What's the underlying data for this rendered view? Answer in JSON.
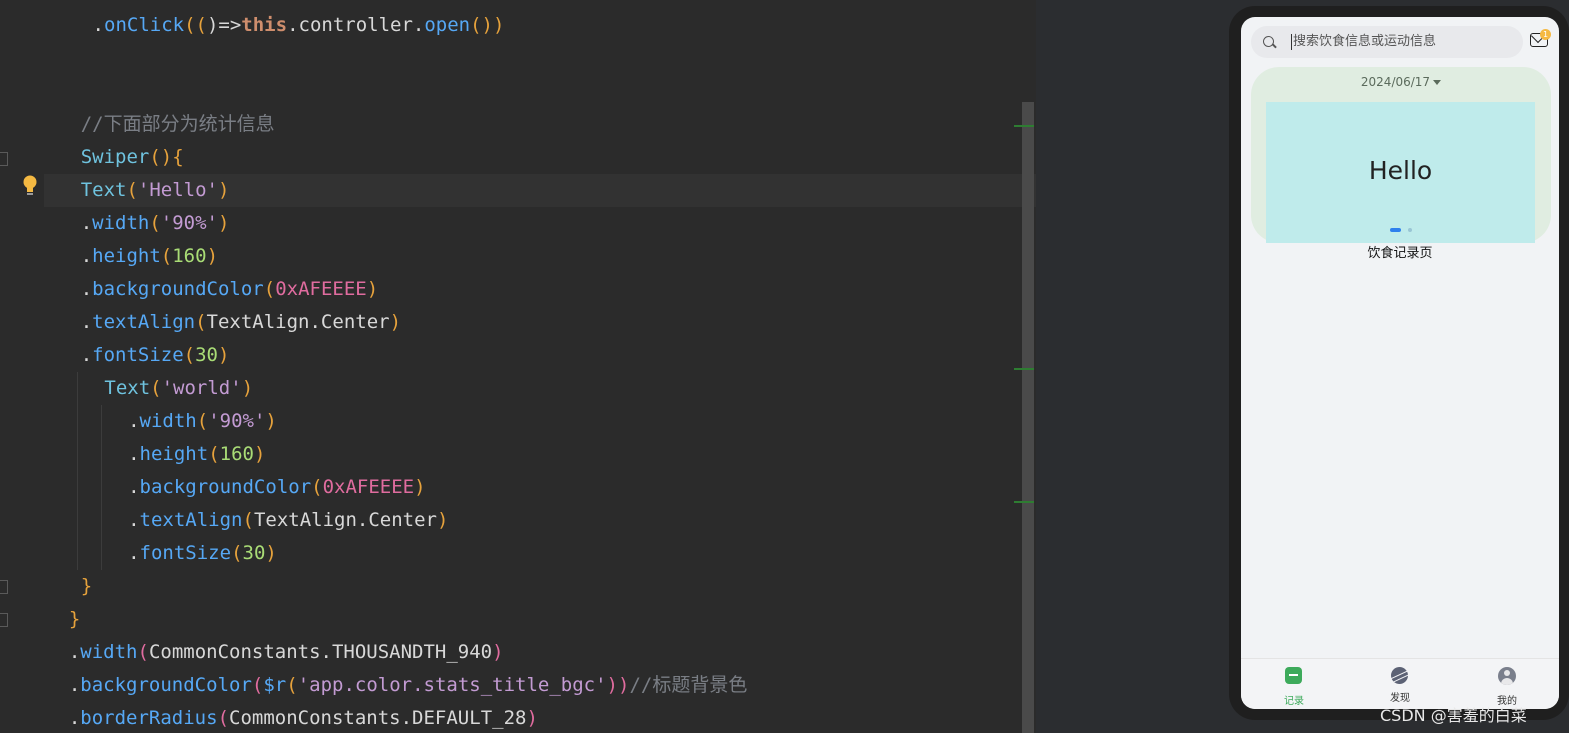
{
  "editor": {
    "lines": [
      {
        "indent": "   ",
        "tokens": [
          {
            "t": ".",
            "c": "#d8d8d8"
          },
          {
            "t": "onClick",
            "c": "#56a8f5"
          },
          {
            "t": "((",
            "c": "#e6a23c"
          },
          {
            "t": ")=>",
            "c": "#d8d8d8"
          },
          {
            "t": "this",
            "c": "#cf8e6d"
          },
          {
            "t": ".controller.",
            "c": "#d8d8d8"
          },
          {
            "t": "open",
            "c": "#56a8f5"
          },
          {
            "t": "())",
            "c": "#e6a23c"
          }
        ]
      },
      {
        "indent": "",
        "tokens": []
      },
      {
        "indent": "",
        "tokens": []
      },
      {
        "indent": "  ",
        "tokens": [
          {
            "t": "//下面部分为统计信息",
            "c": "#7a7e85"
          }
        ]
      },
      {
        "indent": "  ",
        "tokens": [
          {
            "t": "Swiper",
            "c": "#6fc3df"
          },
          {
            "t": "(){",
            "c": "#e6a23c"
          }
        ]
      },
      {
        "indent": "  ",
        "tokens": [
          {
            "t": "Text",
            "c": "#6fc3df"
          },
          {
            "t": "(",
            "c": "#e6a23c"
          },
          {
            "t": "'Hello'",
            "c": "#c39bd3"
          },
          {
            "t": ")",
            "c": "#e6a23c"
          }
        ]
      },
      {
        "indent": "  ",
        "tokens": [
          {
            "t": ".",
            "c": "#d8d8d8"
          },
          {
            "t": "width",
            "c": "#56a8f5"
          },
          {
            "t": "(",
            "c": "#e6a23c"
          },
          {
            "t": "'90%'",
            "c": "#c39bd3"
          },
          {
            "t": ")",
            "c": "#e6a23c"
          }
        ]
      },
      {
        "indent": "  ",
        "tokens": [
          {
            "t": ".",
            "c": "#d8d8d8"
          },
          {
            "t": "height",
            "c": "#56a8f5"
          },
          {
            "t": "(",
            "c": "#e6a23c"
          },
          {
            "t": "160",
            "c": "#a9dc76"
          },
          {
            "t": ")",
            "c": "#e6a23c"
          }
        ]
      },
      {
        "indent": "  ",
        "tokens": [
          {
            "t": ".",
            "c": "#d8d8d8"
          },
          {
            "t": "backgroundColor",
            "c": "#56a8f5"
          },
          {
            "t": "(",
            "c": "#e6a23c"
          },
          {
            "t": "0xAFEEEE",
            "c": "#e06c9f"
          },
          {
            "t": ")",
            "c": "#e6a23c"
          }
        ]
      },
      {
        "indent": "  ",
        "tokens": [
          {
            "t": ".",
            "c": "#d8d8d8"
          },
          {
            "t": "textAlign",
            "c": "#56a8f5"
          },
          {
            "t": "(",
            "c": "#e6a23c"
          },
          {
            "t": "TextAlign.Center",
            "c": "#d8d8d8"
          },
          {
            "t": ")",
            "c": "#e6a23c"
          }
        ]
      },
      {
        "indent": "  ",
        "tokens": [
          {
            "t": ".",
            "c": "#d8d8d8"
          },
          {
            "t": "fontSize",
            "c": "#56a8f5"
          },
          {
            "t": "(",
            "c": "#e6a23c"
          },
          {
            "t": "30",
            "c": "#a9dc76"
          },
          {
            "t": ")",
            "c": "#e6a23c"
          }
        ]
      },
      {
        "indent": "    ",
        "tokens": [
          {
            "t": "Text",
            "c": "#6fc3df"
          },
          {
            "t": "(",
            "c": "#e6a23c"
          },
          {
            "t": "'world'",
            "c": "#c39bd3"
          },
          {
            "t": ")",
            "c": "#e6a23c"
          }
        ]
      },
      {
        "indent": "      ",
        "tokens": [
          {
            "t": ".",
            "c": "#d8d8d8"
          },
          {
            "t": "width",
            "c": "#56a8f5"
          },
          {
            "t": "(",
            "c": "#e6a23c"
          },
          {
            "t": "'90%'",
            "c": "#c39bd3"
          },
          {
            "t": ")",
            "c": "#e6a23c"
          }
        ]
      },
      {
        "indent": "      ",
        "tokens": [
          {
            "t": ".",
            "c": "#d8d8d8"
          },
          {
            "t": "height",
            "c": "#56a8f5"
          },
          {
            "t": "(",
            "c": "#e6a23c"
          },
          {
            "t": "160",
            "c": "#a9dc76"
          },
          {
            "t": ")",
            "c": "#e6a23c"
          }
        ]
      },
      {
        "indent": "      ",
        "tokens": [
          {
            "t": ".",
            "c": "#d8d8d8"
          },
          {
            "t": "backgroundColor",
            "c": "#56a8f5"
          },
          {
            "t": "(",
            "c": "#e6a23c"
          },
          {
            "t": "0xAFEEEE",
            "c": "#e06c9f"
          },
          {
            "t": ")",
            "c": "#e6a23c"
          }
        ]
      },
      {
        "indent": "      ",
        "tokens": [
          {
            "t": ".",
            "c": "#d8d8d8"
          },
          {
            "t": "textAlign",
            "c": "#56a8f5"
          },
          {
            "t": "(",
            "c": "#e6a23c"
          },
          {
            "t": "TextAlign.Center",
            "c": "#d8d8d8"
          },
          {
            "t": ")",
            "c": "#e6a23c"
          }
        ]
      },
      {
        "indent": "      ",
        "tokens": [
          {
            "t": ".",
            "c": "#d8d8d8"
          },
          {
            "t": "fontSize",
            "c": "#56a8f5"
          },
          {
            "t": "(",
            "c": "#e6a23c"
          },
          {
            "t": "30",
            "c": "#a9dc76"
          },
          {
            "t": ")",
            "c": "#e6a23c"
          }
        ]
      },
      {
        "indent": "  ",
        "tokens": [
          {
            "t": "}",
            "c": "#e6a23c"
          }
        ]
      },
      {
        "indent": " ",
        "tokens": [
          {
            "t": "}",
            "c": "#e6a23c"
          }
        ]
      },
      {
        "indent": " ",
        "tokens": [
          {
            "t": ".",
            "c": "#d8d8d8"
          },
          {
            "t": "width",
            "c": "#56a8f5"
          },
          {
            "t": "(",
            "c": "#e06c9f"
          },
          {
            "t": "CommonConstants.THOUSANDTH_940",
            "c": "#d8d8d8"
          },
          {
            "t": ")",
            "c": "#e06c9f"
          }
        ]
      },
      {
        "indent": " ",
        "tokens": [
          {
            "t": ".",
            "c": "#d8d8d8"
          },
          {
            "t": "backgroundColor",
            "c": "#56a8f5"
          },
          {
            "t": "(",
            "c": "#e06c9f"
          },
          {
            "t": "$r",
            "c": "#56a8f5"
          },
          {
            "t": "(",
            "c": "#e6a23c"
          },
          {
            "t": "'app.color.stats_title_bgc'",
            "c": "#c39bd3"
          },
          {
            "t": "))",
            "c": "#e06c9f"
          },
          {
            "t": "//标题背景色",
            "c": "#7a7e85"
          }
        ]
      },
      {
        "indent": " ",
        "tokens": [
          {
            "t": ".",
            "c": "#d8d8d8"
          },
          {
            "t": "borderRadius",
            "c": "#56a8f5"
          },
          {
            "t": "(",
            "c": "#e06c9f"
          },
          {
            "t": "CommonConstants.DEFAULT_28",
            "c": "#d8d8d8"
          },
          {
            "t": ")",
            "c": "#e06c9f"
          }
        ]
      }
    ]
  },
  "phone": {
    "search_placeholder": "搜索饮食信息或运动信息",
    "mail_badge": "1",
    "date": "2024/06/17",
    "swiper_text": "Hello",
    "page_label": "饮食记录页",
    "tabs": {
      "record": {
        "label": "记录",
        "color": "#3daa5b"
      },
      "discover": {
        "label": "发现",
        "color": "#333333"
      },
      "mine": {
        "label": "我的",
        "color": "#333333"
      }
    }
  },
  "watermark": "CSDN @害羞的白菜"
}
